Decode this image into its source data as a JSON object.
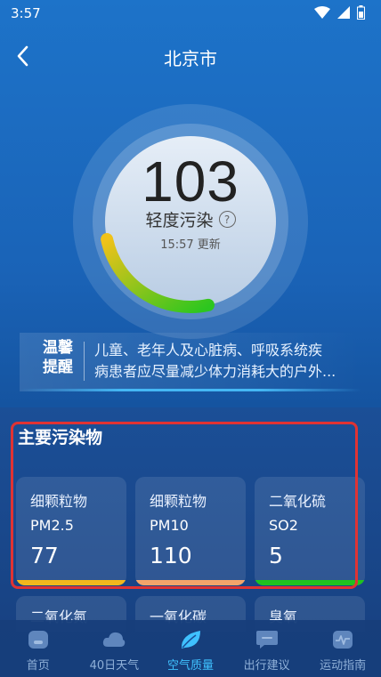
{
  "status": {
    "time": "3:57"
  },
  "header": {
    "title": "北京市"
  },
  "aqi": {
    "value": "103",
    "level": "轻度污染",
    "help_symbol": "?",
    "update_text": "15:57 更新",
    "gauge_fraction": 0.2
  },
  "tips": {
    "badge_line1": "温馨",
    "badge_line2": "提醒",
    "text_line1": "儿童、老年人及心脏病、呼吸系统疾",
    "text_line2": "病患者应尽量减少体力消耗大的户外..."
  },
  "pollutants": {
    "title": "主要污染物",
    "cards": [
      {
        "name": "细颗粒物",
        "code": "PM2.5",
        "value": "77",
        "color": "#f2b81c"
      },
      {
        "name": "细颗粒物",
        "code": "PM10",
        "value": "110",
        "color": "#f3a46a"
      },
      {
        "name": "二氧化硫",
        "code": "SO2",
        "value": "5",
        "color": "#1fc21f"
      }
    ],
    "more_cards": [
      "二氧化氮",
      "一氧化碳",
      "臭氧"
    ]
  },
  "nav": {
    "items": [
      {
        "label": "首页",
        "icon": "home-icon"
      },
      {
        "label": "40日天气",
        "icon": "cloud-icon"
      },
      {
        "label": "空气质量",
        "icon": "leaf-icon"
      },
      {
        "label": "出行建议",
        "icon": "chat-icon"
      },
      {
        "label": "运动指南",
        "icon": "pulse-icon"
      }
    ],
    "active_index": 2
  },
  "colors": {
    "gauge_start": "#f1c219",
    "gauge_end": "#2cc61f",
    "active_nav": "#3fc1ff",
    "highlight_frame": "#e03333"
  }
}
